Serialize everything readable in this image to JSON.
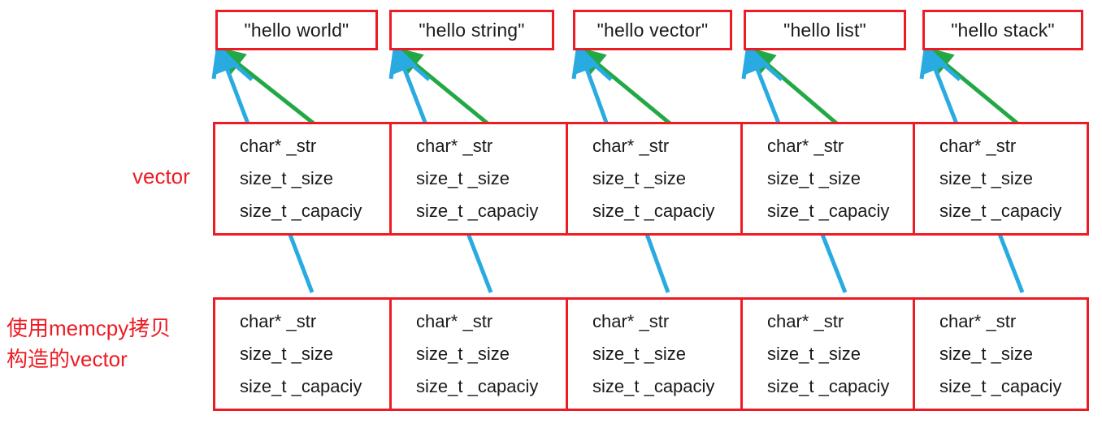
{
  "diagram": {
    "title": "vector of strings memcpy copy construction",
    "colors": {
      "border_red": "#ED1C24",
      "arrow_blue": "#29ABE2",
      "arrow_green": "#22A845",
      "text_dark": "#1A1A1A",
      "background": "#FFFFFF"
    },
    "labels": {
      "vector": "vector",
      "memcpy_vector": "使用memcpy拷贝\n构造的vector"
    },
    "strings": [
      {
        "text": "\"hello world\""
      },
      {
        "text": "\"hello string\""
      },
      {
        "text": "\"hello vector\""
      },
      {
        "text": "\"hello list\""
      },
      {
        "text": "\"hello stack\""
      }
    ],
    "struct_fields": [
      "char* _str",
      "size_t _size",
      "size_t _capaciy"
    ],
    "rows": [
      {
        "name": "vector",
        "cells": [
          {
            "fields": [
              "char* _str",
              "size_t _size",
              "size_t _capaciy"
            ]
          },
          {
            "fields": [
              "char* _str",
              "size_t _size",
              "size_t _capaciy"
            ]
          },
          {
            "fields": [
              "char* _str",
              "size_t _size",
              "size_t _capaciy"
            ]
          },
          {
            "fields": [
              "char* _str",
              "size_t _size",
              "size_t _capaciy"
            ]
          },
          {
            "fields": [
              "char* _str",
              "size_t _size",
              "size_t _capaciy"
            ]
          }
        ]
      },
      {
        "name": "memcpy-constructed-vector",
        "cells": [
          {
            "fields": [
              "char* _str",
              "size_t _size",
              "size_t _capaciy"
            ]
          },
          {
            "fields": [
              "char* _str",
              "size_t _size",
              "size_t _capaciy"
            ]
          },
          {
            "fields": [
              "char* _str",
              "size_t _size",
              "size_t _capaciy"
            ]
          },
          {
            "fields": [
              "char* _str",
              "size_t _size",
              "size_t _capaciy"
            ]
          },
          {
            "fields": [
              "char* _str",
              "size_t _size",
              "size_t _capaciy"
            ]
          }
        ]
      }
    ],
    "arrows": {
      "green_note": "green arrow: original vector element _str points to string literal",
      "blue_note": "blue arrow: memcpy-copied vector element _str points to same string literal"
    }
  }
}
